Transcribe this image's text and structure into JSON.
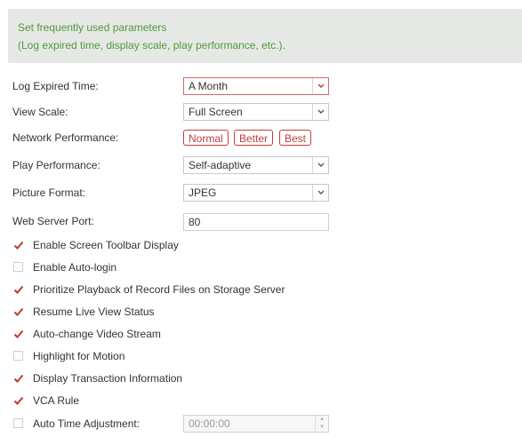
{
  "banner": {
    "line1": "Set frequently used parameters",
    "line2": "(Log expired time, display scale, play performance, etc.)."
  },
  "colors": {
    "accent": "#c93a3a",
    "banner_text": "#4f9a3a",
    "banner_bg": "#e6e8e6",
    "check": "#c0392b"
  },
  "fields": {
    "log_expired": {
      "label": "Log Expired Time:",
      "value": "A Month"
    },
    "view_scale": {
      "label": "View Scale:",
      "value": "Full Screen"
    },
    "network": {
      "label": "Network Performance:",
      "options": [
        "Normal",
        "Better",
        "Best"
      ]
    },
    "play_perf": {
      "label": "Play Performance:",
      "value": "Self-adaptive"
    },
    "picture_format": {
      "label": "Picture Format:",
      "value": "JPEG"
    },
    "web_port": {
      "label": "Web Server Port:",
      "value": "80"
    }
  },
  "checkboxes": [
    {
      "label": "Enable Screen Toolbar Display",
      "checked": true
    },
    {
      "label": "Enable Auto-login",
      "checked": false
    },
    {
      "label": "Prioritize Playback of Record Files on Storage Server",
      "checked": true
    },
    {
      "label": "Resume Live View Status",
      "checked": true
    },
    {
      "label": "Auto-change Video Stream",
      "checked": true
    },
    {
      "label": "Highlight for Motion",
      "checked": false
    },
    {
      "label": "Display Transaction Information",
      "checked": true
    },
    {
      "label": "VCA Rule",
      "checked": true
    },
    {
      "label": "Auto Time Adjustment:",
      "checked": false
    }
  ],
  "auto_time": {
    "value": "00:00:00"
  },
  "icons": {
    "dropdown": "chevron-down-icon",
    "check": "check-icon",
    "spinner": "spinner-icon"
  }
}
